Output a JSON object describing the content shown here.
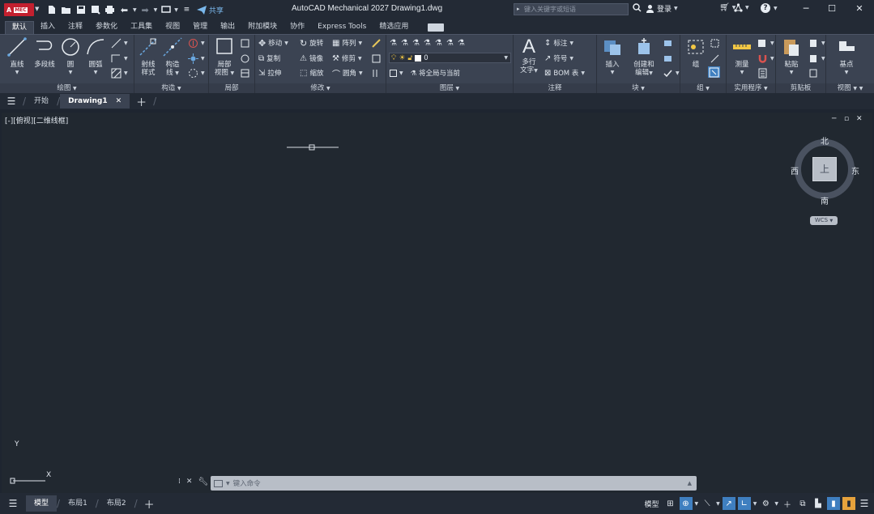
{
  "app": {
    "logo_text": "A",
    "logo_badge": "MEC",
    "title": "AutoCAD Mechanical 2027   Drawing1.dwg",
    "share_label": "共享",
    "search_placeholder": "键入关键字或短语",
    "login_label": "登录"
  },
  "ribbon_tabs": [
    "默认",
    "插入",
    "注释",
    "参数化",
    "工具集",
    "视图",
    "管理",
    "输出",
    "附加模块",
    "协作",
    "Express Tools",
    "精选应用"
  ],
  "ribbon_active_tab": "默认",
  "panels": {
    "draw": {
      "title": "绘图",
      "line": "直线",
      "polyline": "多段线",
      "circle": "圆",
      "arc": "圆弧"
    },
    "construct": {
      "title": "构造",
      "ray_style_1": "射线",
      "ray_style_2": "样式",
      "construct_1": "构造",
      "construct_2": "线"
    },
    "detail": {
      "title": "局部",
      "detail_1": "局部",
      "detail_2": "视图"
    },
    "modify": {
      "title": "修改",
      "move": "移动",
      "rotate": "旋转",
      "array": "阵列",
      "copy": "复制",
      "mirror": "镜像",
      "fillet": "修剪",
      "stretch": "拉伸",
      "scale": "缩放",
      "round": "圆角"
    },
    "layers": {
      "title": "图层",
      "layer_value": "0",
      "match_layer": "将全局与当前"
    },
    "annotation": {
      "title": "注释",
      "mtext_1": "多行",
      "mtext_2": "文字",
      "dim": "标注",
      "sym": "符号",
      "bom": "BOM 表"
    },
    "block": {
      "title": "块",
      "insert": "插入",
      "create_1": "创建和",
      "create_2": "编辑"
    },
    "groups": {
      "title": "组",
      "group": "组"
    },
    "utilities": {
      "title": "实用程序",
      "measure": "测量"
    },
    "clipboard": {
      "title": "剪贴板",
      "paste": "粘贴"
    },
    "view": {
      "title": "视图",
      "base": "基点"
    }
  },
  "file_tabs": {
    "start": "开始",
    "drawing": "Drawing1"
  },
  "viewport": {
    "label": "[-][俯视][二维线框]",
    "viewcube_face": "上",
    "north": "北",
    "south": "南",
    "east": "东",
    "west": "西",
    "wcs": "WCS",
    "ucs_y": "Y",
    "ucs_x": "X"
  },
  "command": {
    "placeholder": "键入命令"
  },
  "status": {
    "model_tab": "模型",
    "layout1": "布局1",
    "layout2": "布局2",
    "model_button": "模型"
  },
  "colors": {
    "accent": "#3f7fc0",
    "logo_red": "#c3202f",
    "canvas": "#212830"
  }
}
